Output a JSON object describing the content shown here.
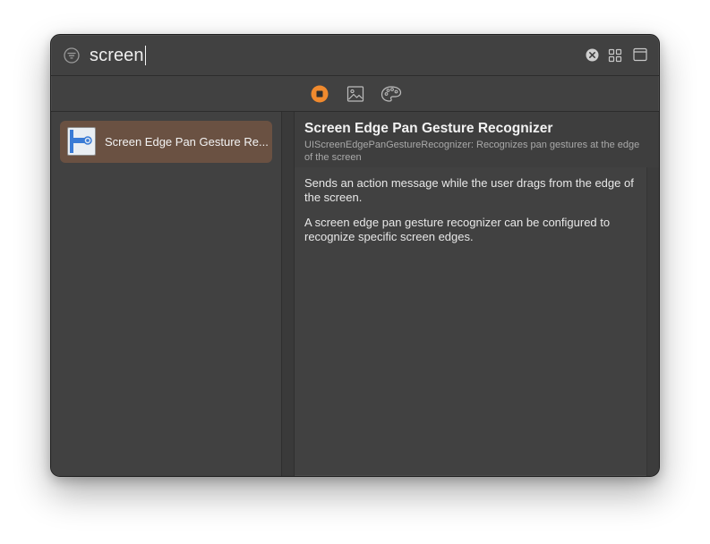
{
  "search": {
    "query": "screen"
  },
  "icons": {
    "filter": "filter-circle-icon",
    "clear": "clear-circle-icon",
    "grid": "grid-view-icon",
    "window": "window-layout-icon",
    "objects_tab": "objects-library-icon",
    "media_tab": "media-library-icon",
    "colors_tab": "color-palette-icon",
    "result_thumb": "screen-edge-pan-gesture-icon"
  },
  "colors": {
    "accent": "#f08a2e",
    "selection": "#6a5142",
    "window_bg": "#414141"
  },
  "results": [
    {
      "label": "Screen Edge Pan Gesture Re...",
      "selected": true
    }
  ],
  "detail": {
    "title": "Screen Edge Pan Gesture Recognizer",
    "subtitle": "UIScreenEdgePanGestureRecognizer: Recognizes pan gestures at the edge of the screen",
    "paragraphs": [
      "Sends an action message while the user drags from the edge of the screen.",
      "A screen edge pan gesture recognizer can be configured to recognize specific screen edges."
    ]
  }
}
